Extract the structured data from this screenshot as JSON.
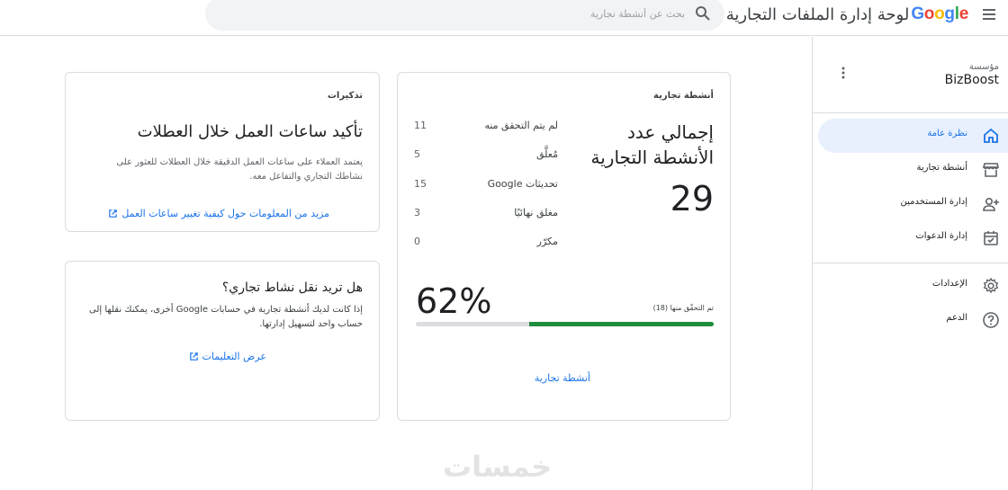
{
  "header": {
    "logo_text": "Google",
    "title": "لوحة إدارة الملفات التجارية",
    "search_placeholder": "بحث عن أنشطة تجارية",
    "logo_colors": [
      "#4285F4",
      "#EA4335",
      "#FBBC05",
      "#4285F4",
      "#34A853",
      "#EA4335"
    ]
  },
  "sidebar": {
    "org_label": "مؤسسة",
    "org_name": "BizBoost",
    "items": [
      {
        "label": "نظرة عامة",
        "icon": "home-icon"
      },
      {
        "label": "أنشطة تجارية",
        "icon": "storefront-icon"
      },
      {
        "label": "إدارة المستخدمين",
        "icon": "person-add-icon"
      },
      {
        "label": "إدارة الدعوات",
        "icon": "calendar-check-icon"
      },
      {
        "label": "الإعدادات",
        "icon": "gear-icon"
      },
      {
        "label": "الدعم",
        "icon": "help-icon"
      }
    ]
  },
  "business_card": {
    "label": "أنشطة تجارية",
    "total_title": "إجمالي عدد الأنشطة التجارية",
    "total_value": "29",
    "stats": [
      {
        "label": "لم يتم التحقق منه",
        "value": "11"
      },
      {
        "label": "مُعلَّق",
        "value": "5"
      },
      {
        "label": "تحديثات Google",
        "value": "15"
      },
      {
        "label": "مغلق نهائيًا",
        "value": "3"
      },
      {
        "label": "مكرّر",
        "value": "0"
      }
    ],
    "verified_label": "تم التحقّق منها (18)",
    "percent_text": "62%",
    "progress": 0.62,
    "link": "أنشطة تجارية"
  },
  "reminders_card": {
    "label": "تذكيرات",
    "title": "تأكيد ساعات العمل خلال العطلات",
    "body": "يعتمد العملاء على ساعات العمل الدقيقة خلال العطلات للعثور على نشاطك التجاري والتفاعل معه.",
    "link": "مزيد من المعلومات حول كيفية تغيير ساعات العمل"
  },
  "transfer_card": {
    "title": "هل تريد نقل نشاط تجاري؟",
    "body": "إذا كانت لديك أنشطة تجارية في حسابات Google أخرى، يمكنك نقلها إلى حساب واحد لتسهيل إدارتها.",
    "link": "عرض التعليمات"
  },
  "watermark": "خمسات",
  "colors": {
    "accent": "#1a73e8",
    "active_nav_bg": "#e8f0fe",
    "progress": "#1e8e3e",
    "border": "#dadce0"
  }
}
